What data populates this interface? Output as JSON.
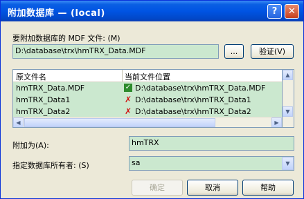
{
  "window": {
    "title": "附加数据库 — (local)",
    "help_glyph": "?",
    "close_glyph": "✕"
  },
  "mdf": {
    "label": "要附加数据库的 MDF 文件: (M)",
    "value": "D:\\database\\trx\\hmTRX_Data.MDF",
    "browse_label": "...",
    "verify_label": "验证(V)"
  },
  "grid": {
    "headers": [
      "原文件名",
      "当前文件位置"
    ],
    "rows": [
      {
        "name": "hmTRX_Data.MDF",
        "status": "ok",
        "path": "D:\\database\\trx\\hmTRX_Data.MDF"
      },
      {
        "name": "hmTRX_Data1",
        "status": "error",
        "path": "D:\\database\\trx\\hmTRX_Data1"
      },
      {
        "name": "hmTRX_Data2",
        "status": "error",
        "path": "D:\\database\\trx\\hmTRX_Data2"
      }
    ]
  },
  "attach_as": {
    "label": "附加为(A):",
    "value": "hmTRX"
  },
  "owner": {
    "label": "指定数据库所有者: (S)",
    "value": "sa"
  },
  "buttons": {
    "ok": "确定",
    "cancel": "取消",
    "help": "帮助"
  },
  "icons": {
    "ok": "check-icon",
    "error": "x-icon"
  }
}
